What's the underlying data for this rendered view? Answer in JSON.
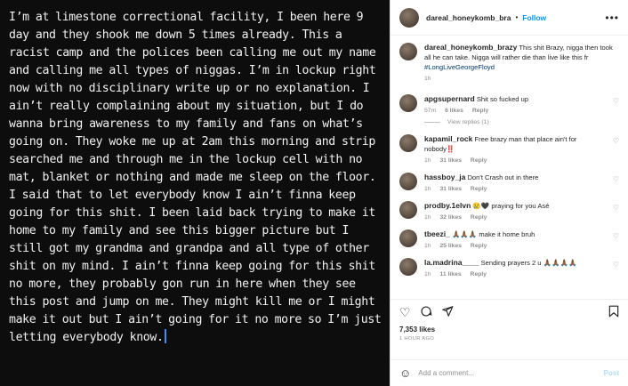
{
  "post_text": "I’m at limestone correctional facility, I been here 9 day and they shook me down 5 times already. This a racist camp and the polices been calling me out my name and calling me all types of niggas. I’m in lockup right now with no disciplinary write up or no explanation. I ain’t really complaining about my situation, but I do wanna bring awareness to my family and fans on what’s going on. They woke me up at 2am this morning and strip searched me and through me in the lockup cell with no mat, blanket or nothing and made me sleep on the floor. I said that to let everybody know I ain’t finna keep going for this shit. I been laid back trying to make it home to my family and see this bigger picture but I still got my grandma and grandpa and all type of other shit on my mind. I ain’t finna keep going for this shit no more, they probably gon run in here when they see this post and jump on me. They might kill me or I might make it out but I ain’t going for it no more so I’m just letting everybody know.",
  "header": {
    "username": "dareal_honeykomb_bra",
    "separator": "•",
    "follow": "Follow",
    "more": "•••"
  },
  "caption": {
    "username": "dareal_honeykomb_brazy",
    "text": "This shit Brazy, nigga then took all he can take. Nigga will rather die than live like this fr",
    "hashtag": "#LongLiveGeorgeFloyd",
    "time": "1h"
  },
  "comments": [
    {
      "user": "apgsupernard",
      "text": "Shit so fucked up",
      "time": "57m",
      "likes": "6 likes",
      "reply": "Reply",
      "view_replies": "View replies (1)"
    },
    {
      "user": "kapamil_rock",
      "text": "Free brazy man that place ain't for nobody‼️",
      "time": "1h",
      "likes": "31 likes",
      "reply": "Reply"
    },
    {
      "user": "hassboy_ja",
      "text": "Don't Crash out in there",
      "time": "1h",
      "likes": "31 likes",
      "reply": "Reply"
    },
    {
      "user": "prodby.1elvn",
      "text": "😢🖤 praying for you Asé",
      "time": "1h",
      "likes": "32 likes",
      "reply": "Reply"
    },
    {
      "user": "tbeezi_",
      "text": "🙏🏾🙏🏾🙏🏾 make it home bruh",
      "time": "1h",
      "likes": "25 likes",
      "reply": "Reply"
    },
    {
      "user": "la.madrina____",
      "text": "Sending prayers 2 u 🙏🏾🙏🏾🙏🏾🙏🏾",
      "time": "1h",
      "likes": "11 likes",
      "reply": "Reply"
    }
  ],
  "actions": {
    "likes": "7,353 likes",
    "time_ago": "1 HOUR AGO",
    "add_comment_placeholder": "Add a comment...",
    "post_label": "Post"
  },
  "icons": [
    "heart-icon",
    "comment-icon",
    "share-icon",
    "bookmark-icon",
    "smile-icon",
    "more-icon"
  ],
  "colors": {
    "link": "#0095f6",
    "hashtag": "#00376b",
    "background_image": "#0d0d0d"
  }
}
